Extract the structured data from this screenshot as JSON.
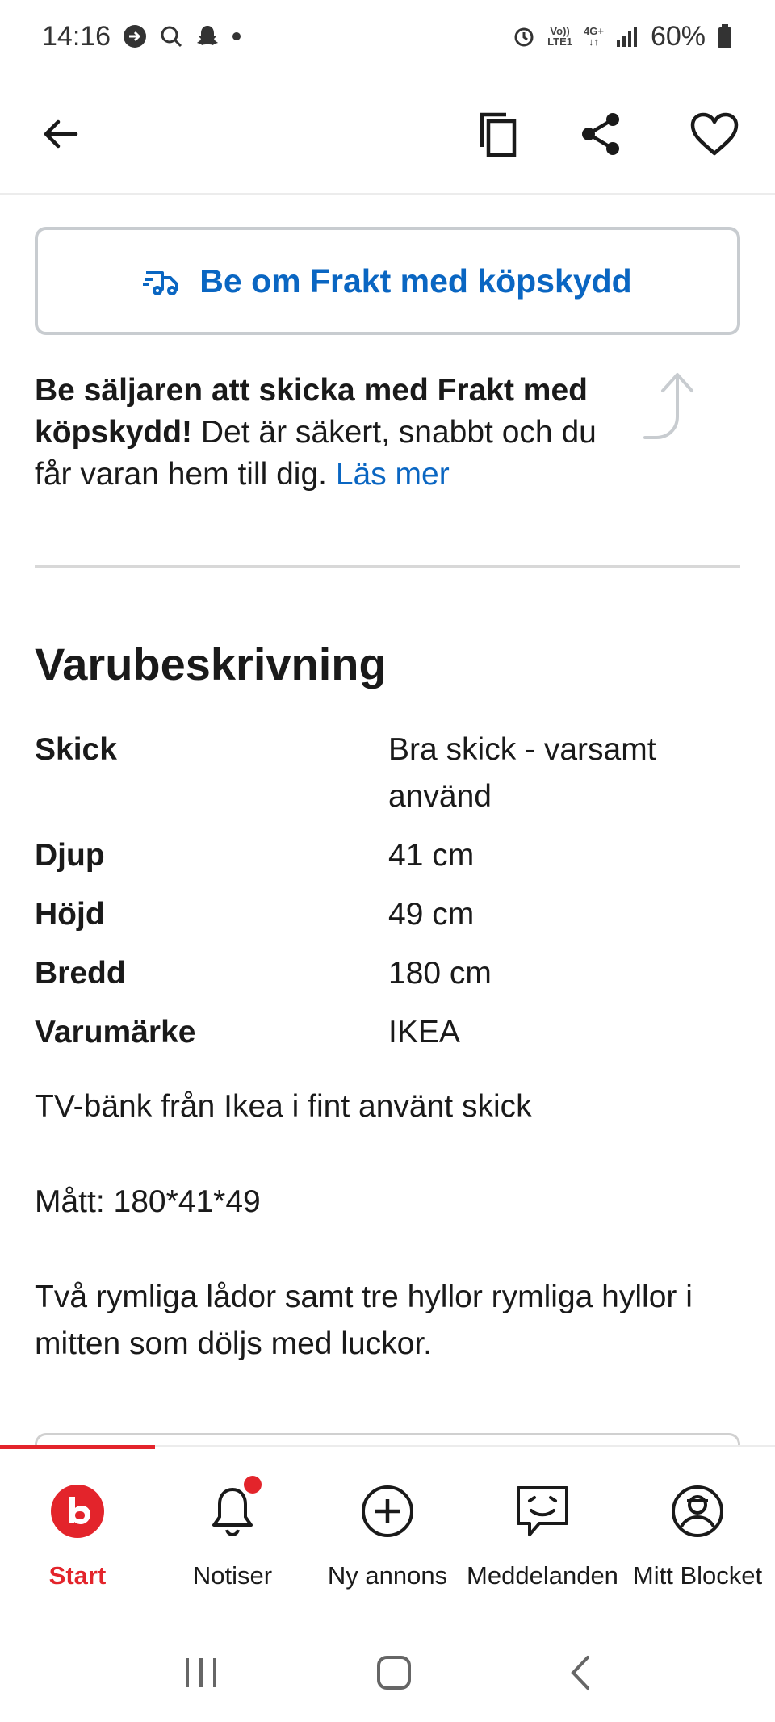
{
  "status_bar": {
    "time": "14:16",
    "battery": "60%",
    "network_top": "Vo))",
    "network_bottom": "LTE1",
    "network_type": "4G+"
  },
  "header": {
    "back_icon": "arrow-left-icon",
    "copy_icon": "copy-icon",
    "share_icon": "share-icon",
    "favorite_icon": "heart-icon"
  },
  "shipping": {
    "button_label": "Be om Frakt med köpskydd",
    "info_bold": "Be säljaren att skicka med Frakt med köpskydd!",
    "info_text": " Det är säkert, snabbt och du får varan hem till dig. ",
    "info_link": "Läs mer"
  },
  "description": {
    "title": "Varubeskrivning",
    "specs": [
      {
        "key": "Skick",
        "value": "Bra skick - varsamt använd"
      },
      {
        "key": "Djup",
        "value": "41 cm"
      },
      {
        "key": "Höjd",
        "value": "49 cm"
      },
      {
        "key": "Bredd",
        "value": "180 cm"
      },
      {
        "key": "Varumärke",
        "value": "IKEA"
      }
    ],
    "paragraphs": [
      "TV-bänk från Ikea i fint använt skick",
      "Mått: 180*41*49",
      "Två rymliga lådor samt tre hyllor rymliga hyllor i mitten som döljs med luckor."
    ]
  },
  "bottom_nav": {
    "items": [
      {
        "label": "Start",
        "icon": "blocket-logo-icon",
        "active": true
      },
      {
        "label": "Notiser",
        "icon": "bell-icon"
      },
      {
        "label": "Ny annons",
        "icon": "plus-circle-icon"
      },
      {
        "label": "Meddelanden",
        "icon": "chat-icon"
      },
      {
        "label": "Mitt Blocket",
        "icon": "profile-icon"
      }
    ]
  },
  "colors": {
    "accent_blue": "#0a66c2",
    "brand_red": "#e3242b"
  }
}
